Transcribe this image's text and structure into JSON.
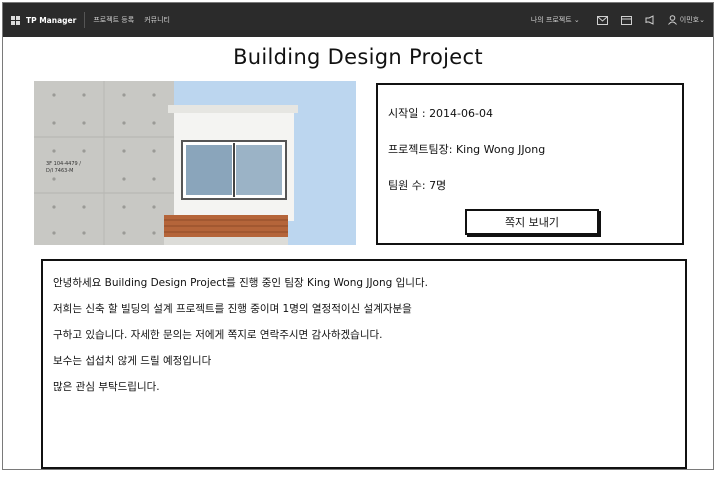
{
  "app": {
    "name": "TP Manager"
  },
  "topbar": {
    "nav": [
      "프로젝트 등록",
      "커뮤니티"
    ],
    "my_project": "나의 프로젝트",
    "user": "이민호",
    "icons": [
      "mail-icon",
      "calendar-icon",
      "notification-icon",
      "user-icon"
    ]
  },
  "project": {
    "title": "Building Design Project",
    "start_label": "시작일 :",
    "start_value": "2014-06-04",
    "leader_label": "프로젝트팀장:",
    "leader_value": "King Wong JJong",
    "members_label": "팀원 수:",
    "members_value": "7명",
    "message_button": "쪽지 보내기"
  },
  "photo": {
    "sign_text": [
      "3F 104-4479 /",
      "D/I 7463-M"
    ]
  },
  "description": {
    "lines": [
      "안녕하세요 Building Design Project를 진행 중인 팀장 King Wong JJong 입니다.",
      "저희는 신축 할 빌딩의 설계 프로젝트를 진행 중이며 1명의 열정적이신 설계자분을",
      "구하고 있습니다. 자세한 문의는 저에게 쪽지로 연락주시면 감사하겠습니다.",
      "보수는 섭섭치 않게 드릴 예정입니다",
      "많은 관심 부탁드립니다."
    ]
  },
  "colors": {
    "topbar": "#2b2b2b",
    "sky": "#bfd7ef",
    "concrete": "#c9c9c6",
    "wood": "#b5653a"
  }
}
